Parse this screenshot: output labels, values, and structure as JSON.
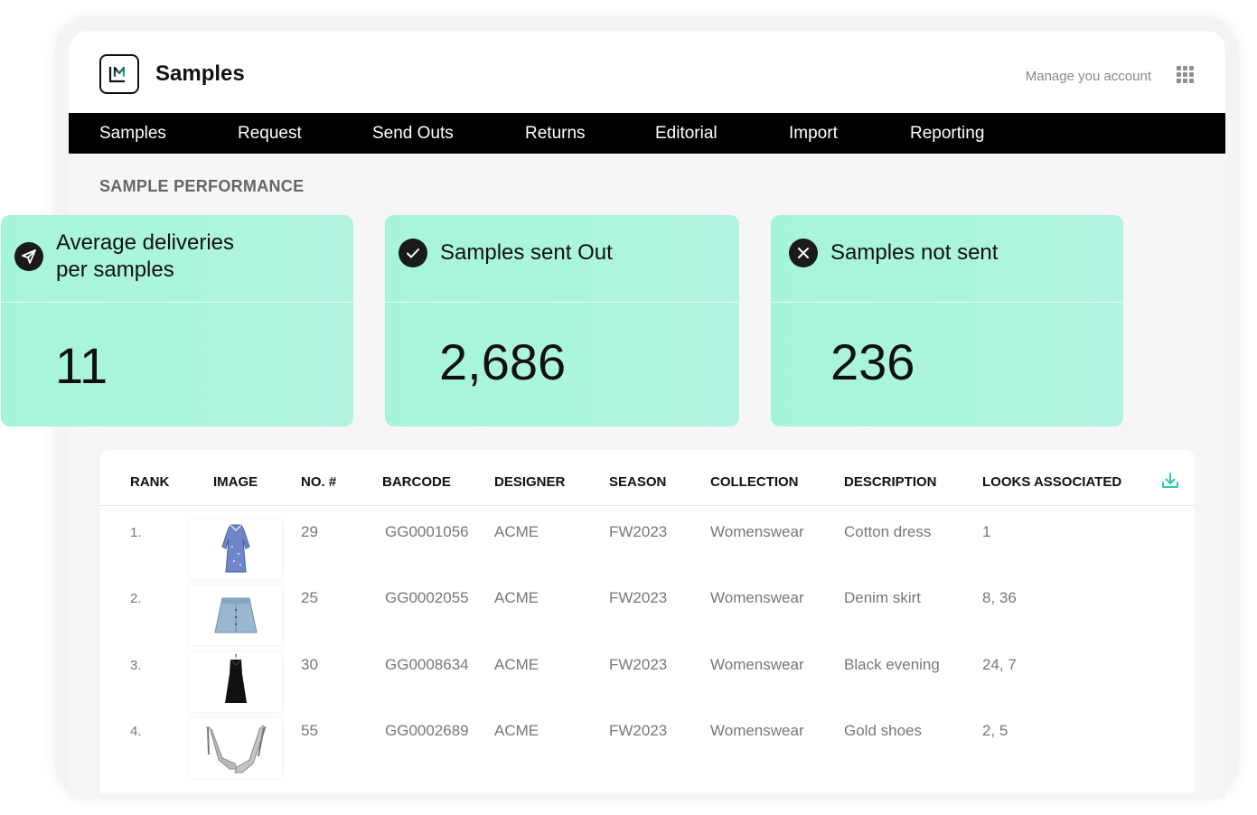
{
  "header": {
    "app_title": "Samples",
    "manage_link": "Manage you account"
  },
  "nav": {
    "items": [
      {
        "label": "Samples"
      },
      {
        "label": "Request"
      },
      {
        "label": "Send Outs"
      },
      {
        "label": "Returns"
      },
      {
        "label": "Editorial"
      },
      {
        "label": "Import"
      },
      {
        "label": "Reporting"
      }
    ]
  },
  "section": {
    "title": "SAMPLE PERFORMANCE"
  },
  "stats": [
    {
      "label_line1": "Average deliveries",
      "label_line2": "per samples",
      "value": "11",
      "icon": "paper-plane-icon"
    },
    {
      "label_line1": "Samples sent Out",
      "label_line2": "",
      "value": "2,686",
      "icon": "check-circle-icon"
    },
    {
      "label_line1": "Samples not sent",
      "label_line2": "",
      "value": "236",
      "icon": "x-circle-icon"
    }
  ],
  "table": {
    "columns": [
      "RANK",
      "IMAGE",
      "NO. #",
      "BARCODE",
      "DESIGNER",
      "SEASON",
      "COLLECTION",
      "DESCRIPTION",
      "LOOKS ASSOCIATED"
    ],
    "rows": [
      {
        "rank": "1.",
        "image": "dress-icon",
        "no": "29",
        "barcode": "GG0001056",
        "designer": "ACME",
        "season": "FW2023",
        "collection": "Womenswear",
        "description": "Cotton dress",
        "looks": "1"
      },
      {
        "rank": "2.",
        "image": "skirt-icon",
        "no": "25",
        "barcode": "GG0002055",
        "designer": "ACME",
        "season": "FW2023",
        "collection": "Womenswear",
        "description": "Denim skirt",
        "looks": "8, 36"
      },
      {
        "rank": "3.",
        "image": "evening-dress-icon",
        "no": "30",
        "barcode": "GG0008634",
        "designer": "ACME",
        "season": "FW2023",
        "collection": "Womenswear",
        "description": "Black evening",
        "looks": "24, 7"
      },
      {
        "rank": "4.",
        "image": "shoes-icon",
        "no": "55",
        "barcode": "GG0002689",
        "designer": "ACME",
        "season": "FW2023",
        "collection": "Womenswear",
        "description": "Gold shoes",
        "looks": "2, 5"
      }
    ]
  },
  "colors": {
    "accent": "#2ec8a6",
    "card_bg": "#a9f5dc",
    "nav_bg": "#000000"
  }
}
